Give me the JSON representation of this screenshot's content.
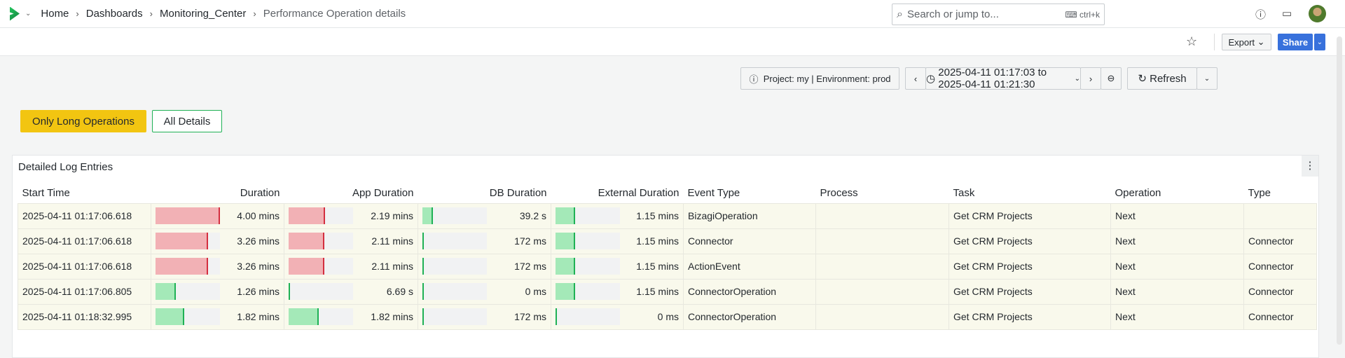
{
  "breadcrumbs": [
    "Home",
    "Dashboards",
    "Monitoring_Center",
    "Performance Operation details"
  ],
  "search": {
    "placeholder": "Search or jump to...",
    "shortcut": "ctrl+k"
  },
  "toolbar": {
    "export": "Export",
    "share": "Share"
  },
  "filters": {
    "context": "Project: my | Environment: prod",
    "time_range": "2025-04-11 01:17:03 to 2025-04-11 01:21:30",
    "refresh": "Refresh"
  },
  "buttons": {
    "long_ops": "Only Long Operations",
    "all_details": "All Details"
  },
  "colors": {
    "long_ops_bg": "#f2c511",
    "share": "#3871dc",
    "long": "#d32f3f",
    "ok": "#1fb155"
  },
  "panel": {
    "title": "Detailed Log Entries",
    "columns": [
      "Start Time",
      "Duration",
      "App Duration",
      "DB Duration",
      "External Duration",
      "Event Type",
      "Process",
      "Task",
      "Operation",
      "Type"
    ],
    "rows": [
      {
        "start": "2025-04-11 01:17:06.618",
        "dur": {
          "t": "4.00 mins",
          "f": 1.0,
          "s": "long"
        },
        "app": {
          "t": "2.19 mins",
          "f": 0.57,
          "s": "long"
        },
        "db": {
          "t": "39.2 s",
          "f": 0.16,
          "s": "ok"
        },
        "ext": {
          "t": "1.15 mins",
          "f": 0.3,
          "s": "ok"
        },
        "event": "BizagiOperation",
        "process": "",
        "task": "Get CRM Projects",
        "operation": "Next",
        "type": ""
      },
      {
        "start": "2025-04-11 01:17:06.618",
        "dur": {
          "t": "3.26 mins",
          "f": 0.82,
          "s": "long"
        },
        "app": {
          "t": "2.11 mins",
          "f": 0.55,
          "s": "long"
        },
        "db": {
          "t": "172 ms",
          "f": 0.0,
          "s": "ok"
        },
        "ext": {
          "t": "1.15 mins",
          "f": 0.3,
          "s": "ok"
        },
        "event": "Connector",
        "process": "",
        "task": "Get CRM Projects",
        "operation": "Next",
        "type": "Connector"
      },
      {
        "start": "2025-04-11 01:17:06.618",
        "dur": {
          "t": "3.26 mins",
          "f": 0.82,
          "s": "long"
        },
        "app": {
          "t": "2.11 mins",
          "f": 0.55,
          "s": "long"
        },
        "db": {
          "t": "172 ms",
          "f": 0.0,
          "s": "ok"
        },
        "ext": {
          "t": "1.15 mins",
          "f": 0.3,
          "s": "ok"
        },
        "event": "ActionEvent",
        "process": "",
        "task": "Get CRM Projects",
        "operation": "Next",
        "type": "Connector"
      },
      {
        "start": "2025-04-11 01:17:06.805",
        "dur": {
          "t": "1.26 mins",
          "f": 0.31,
          "s": "ok"
        },
        "app": {
          "t": "6.69 s",
          "f": 0.0,
          "s": "ok"
        },
        "db": {
          "t": "0 ms",
          "f": 0.0,
          "s": "ok"
        },
        "ext": {
          "t": "1.15 mins",
          "f": 0.3,
          "s": "ok"
        },
        "event": "ConnectorOperation",
        "process": "",
        "task": "Get CRM Projects",
        "operation": "Next",
        "type": "Connector"
      },
      {
        "start": "2025-04-11 01:18:32.995",
        "dur": {
          "t": "1.82 mins",
          "f": 0.45,
          "s": "ok"
        },
        "app": {
          "t": "1.82 mins",
          "f": 0.47,
          "s": "ok"
        },
        "db": {
          "t": "172 ms",
          "f": 0.0,
          "s": "ok"
        },
        "ext": {
          "t": "0 ms",
          "f": 0.0,
          "s": "ok"
        },
        "event": "ConnectorOperation",
        "process": "",
        "task": "Get CRM Projects",
        "operation": "Next",
        "type": "Connector"
      }
    ]
  }
}
